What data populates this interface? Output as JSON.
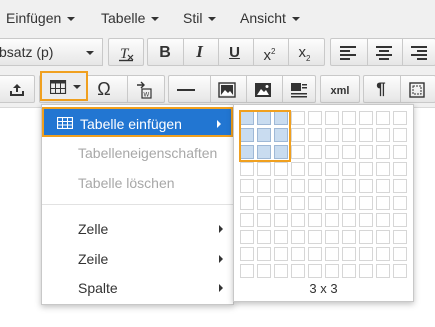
{
  "menubar": {
    "items": [
      {
        "label": "Einfügen"
      },
      {
        "label": "Tabelle"
      },
      {
        "label": "Stil"
      },
      {
        "label": "Ansicht"
      }
    ]
  },
  "toolbar": {
    "format_select": {
      "value": "bsatz (p)"
    },
    "superscript_sub": "2",
    "subscript_sub": "2",
    "xml_label": "xml"
  },
  "table_menu": {
    "items": [
      {
        "label": "Tabelle einfügen",
        "state": "active",
        "submenu": true
      },
      {
        "label": "Tabelleneigenschaften",
        "state": "disabled"
      },
      {
        "label": "Tabelle löschen",
        "state": "disabled"
      },
      {
        "label": "Zelle",
        "submenu": true
      },
      {
        "label": "Zeile",
        "submenu": true
      },
      {
        "label": "Spalte",
        "submenu": true
      }
    ]
  },
  "table_grid": {
    "columns": 10,
    "rows": 10,
    "selected_columns": 3,
    "selected_rows": 3,
    "label": "3 x 3"
  },
  "colors": {
    "accent_focus": "#f0a01f",
    "active_item_bg": "#2276d2",
    "grid_selected": "#c9dcf0"
  }
}
